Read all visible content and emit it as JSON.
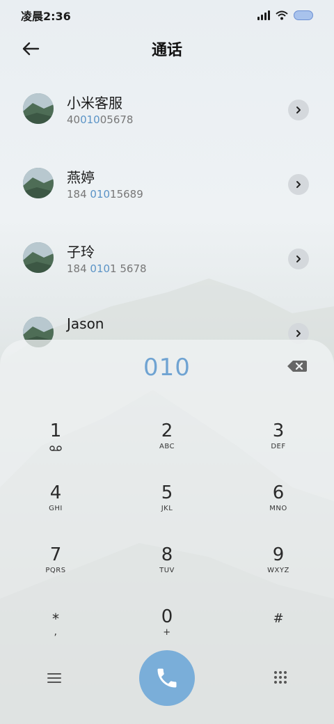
{
  "status_bar": {
    "time": "凌晨2:36",
    "icons": [
      "signal-icon",
      "wifi-icon",
      "battery-icon"
    ]
  },
  "header": {
    "title": "通话",
    "back_icon": "back-arrow-icon"
  },
  "contacts": [
    {
      "name": "小米客服",
      "number_pre": "40",
      "number_hl": "010",
      "number_post": "05678"
    },
    {
      "name": "燕婷",
      "number_pre": "184 ",
      "number_hl": "010",
      "number_post": "15689"
    },
    {
      "name": "子玲",
      "number_pre": "184 ",
      "number_hl": "010",
      "number_post": "1 5678"
    },
    {
      "name": "Jason",
      "number_pre": "",
      "number_hl": "",
      "number_post": ""
    }
  ],
  "dialpad": {
    "input": "010",
    "keys": [
      {
        "digit": "1",
        "sub": ""
      },
      {
        "digit": "2",
        "sub": "ABC"
      },
      {
        "digit": "3",
        "sub": "DEF"
      },
      {
        "digit": "4",
        "sub": "GHI"
      },
      {
        "digit": "5",
        "sub": "JKL"
      },
      {
        "digit": "6",
        "sub": "MNO"
      },
      {
        "digit": "7",
        "sub": "PQRS"
      },
      {
        "digit": "8",
        "sub": "TUV"
      },
      {
        "digit": "9",
        "sub": "WXYZ"
      },
      {
        "digit": "*",
        "sub": ","
      },
      {
        "digit": "0",
        "sub": "+"
      },
      {
        "digit": "#",
        "sub": ""
      }
    ]
  },
  "colors": {
    "accent": "#7aaed9",
    "highlight": "#5b93c6"
  }
}
